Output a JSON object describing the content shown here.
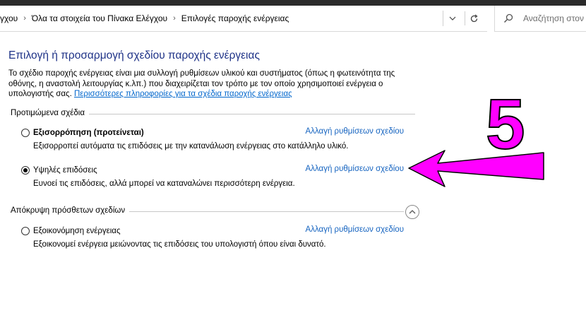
{
  "breadcrumbs": {
    "items": [
      "γχου",
      "Όλα τα στοιχεία του Πίνακα Ελέγχου",
      "Επιλογές παροχής ενέργειας"
    ],
    "separator": "›"
  },
  "search": {
    "placeholder": "Αναζήτηση στον"
  },
  "page": {
    "title": "Επιλογή ή προσαρμογή σχεδίου παροχής ενέργειας",
    "description": "Το σχέδιο παροχής ενέργειας είναι μια συλλογή ρυθμίσεων υλικού και συστήματος (όπως η φωτεινότητα της οθόνης, η αναστολή λειτουργίας κ.λπ.) που διαχειρίζεται τον τρόπο με τον οποίο χρησιμοποιεί ενέργεια ο υπολογιστής σας.",
    "more_info_link": "Περισσότερες πληροφορίες για τα σχέδια παροχής ενέργειας"
  },
  "preferred_plans": {
    "label": "Προτιμώμενα σχέδια",
    "plans": [
      {
        "name": "Εξισορρόπηση (προτείνεται)",
        "bold": true,
        "checked": false,
        "link": "Αλλαγή ρυθμίσεων σχεδίου",
        "description": "Εξισορροπεί αυτόματα τις επιδόσεις με την κατανάλωση ενέργειας στο κατάλληλο υλικό."
      },
      {
        "name": "Υψηλές επιδόσεις",
        "bold": false,
        "checked": true,
        "link": "Αλλαγή ρυθμίσεων σχεδίου",
        "description": "Ευνοεί τις επιδόσεις, αλλά μπορεί να καταναλώνει περισσότερη ενέργεια."
      }
    ]
  },
  "hidden_plans": {
    "label": "Απόκρυψη πρόσθετων σχεδίων",
    "plans": [
      {
        "name": "Εξοικονόμηση ενέργειας",
        "bold": false,
        "checked": false,
        "link": "Αλλαγή ρυθμίσεων σχεδίου",
        "description": "Εξοικονομεί ενέργεια μειώνοντας τις επιδόσεις του υπολογιστή όπου είναι δυνατό."
      }
    ]
  },
  "annotation": {
    "step_number": "5",
    "color": "#ff00ff"
  },
  "icons": {
    "search": "search-icon",
    "refresh": "refresh-icon",
    "dropdown": "chevron-down-icon",
    "collapse": "chevron-up-icon"
  },
  "colors": {
    "title": "#1e3287",
    "link": "#1664c0",
    "annotation": "#ff00ff"
  }
}
